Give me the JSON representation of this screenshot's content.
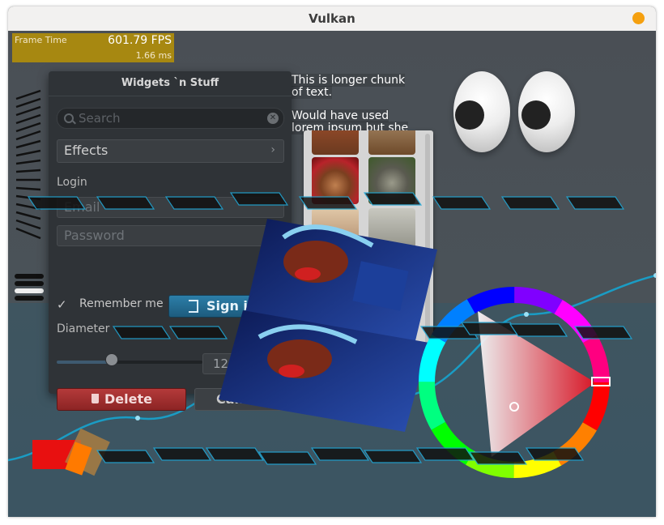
{
  "window": {
    "title": "Vulkan",
    "close_color": "#f5a00f"
  },
  "fps_graph": {
    "label": "Frame Time",
    "value": "601.79 FPS",
    "ms": "1.66 ms"
  },
  "widgets": {
    "title": "Widgets `n Stuff",
    "search": {
      "placeholder": "Search"
    },
    "effects_label": "Effects",
    "login_label": "Login",
    "email_placeholder": "Email",
    "password_placeholder": "Password",
    "remember_label": "Remember me",
    "remember_checked": true,
    "signin_label": "Sign in",
    "diameter_label": "Diameter",
    "diameter_value": "123.00",
    "diameter_slider_fraction": 0.4,
    "delete_label": "Delete",
    "cancel_label": "Cancel"
  },
  "paragraph": {
    "line1": "This is longer chunk",
    "line2": "of text.",
    "line3": "Would have used",
    "line4": "lorem ipsum but she"
  },
  "colors": {
    "accent": "#2c7ea8",
    "danger": "#b43a3a",
    "fps_bg": "#be9600",
    "line_color": "#1a9cc4"
  },
  "icons": [
    "search-icon",
    "clear-icon",
    "chevron-right-icon",
    "checkmark-icon",
    "login-icon",
    "trash-icon"
  ]
}
